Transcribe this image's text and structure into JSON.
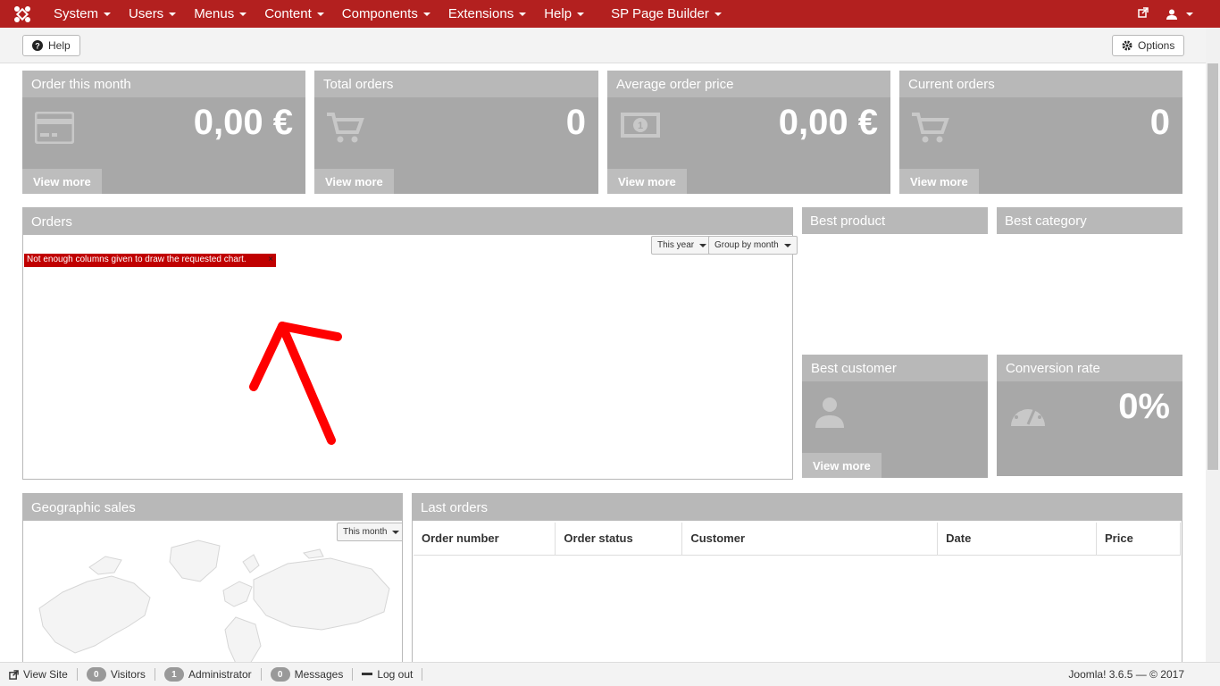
{
  "nav": {
    "items": [
      "System",
      "Users",
      "Menus",
      "Content",
      "Components",
      "Extensions",
      "Help",
      "SP Page Builder"
    ]
  },
  "toolbar": {
    "help_label": "Help",
    "options_label": "Options"
  },
  "stats": [
    {
      "title": "Order this month",
      "value": "0,00 €",
      "link": "View more",
      "icon": "credit-card-icon"
    },
    {
      "title": "Total orders",
      "value": "0",
      "link": "View more",
      "icon": "cart-icon"
    },
    {
      "title": "Average order price",
      "value": "0,00 €",
      "link": "View more",
      "icon": "money-icon"
    },
    {
      "title": "Current orders",
      "value": "0",
      "link": "View more",
      "icon": "cart-icon"
    }
  ],
  "orders_panel": {
    "title": "Orders",
    "period_filter": "This year",
    "group_filter": "Group by month",
    "error": "Not enough columns given to draw the requested chart.",
    "error_close": "×"
  },
  "best_product": {
    "title": "Best product"
  },
  "best_category": {
    "title": "Best category"
  },
  "best_customer": {
    "title": "Best customer",
    "link": "View more",
    "icon": "user-icon"
  },
  "conversion": {
    "title": "Conversion rate",
    "value": "0%",
    "icon": "dashboard-icon"
  },
  "geo": {
    "title": "Geographic sales",
    "filter": "This month"
  },
  "last_orders": {
    "title": "Last orders",
    "columns": [
      "Order number",
      "Order status",
      "Customer",
      "Date",
      "Price"
    ]
  },
  "statusbar": {
    "view_site": "View Site",
    "visitors_count": "0",
    "visitors_label": "Visitors",
    "admin_count": "1",
    "admin_label": "Administrator",
    "messages_count": "0",
    "messages_label": "Messages",
    "logout": "Log out",
    "footer": "Joomla! 3.6.5 — © 2017"
  },
  "colors": {
    "brand": "#b3201f",
    "widget": "#a8a8a8",
    "error": "#c00000",
    "annotation": "#ff0000"
  }
}
